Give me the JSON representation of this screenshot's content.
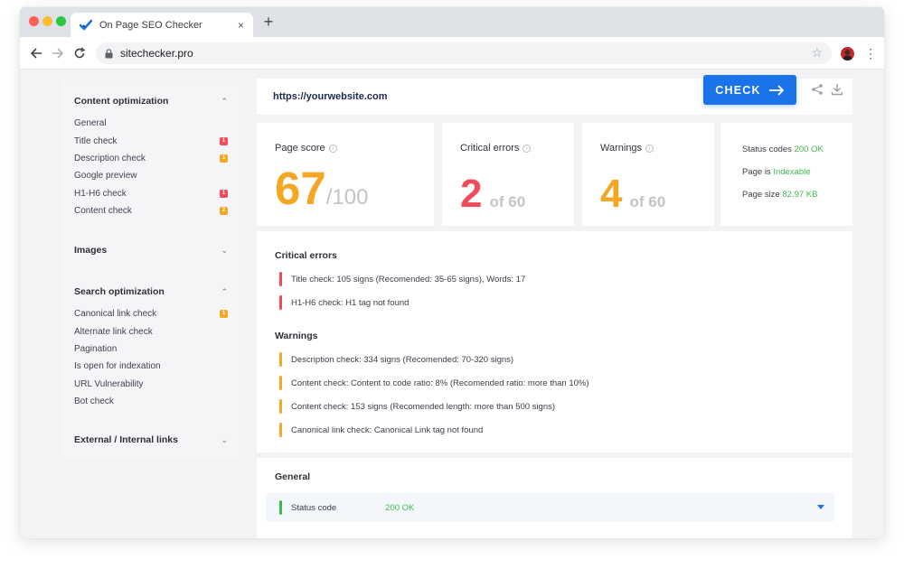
{
  "browser": {
    "tab_title": "On Page SEO Checker",
    "tab_close": "×",
    "new_tab": "+",
    "url": "sitechecker.pro",
    "bookmark_star": "☆",
    "menu": "⋮"
  },
  "sidebar": {
    "sections": [
      {
        "title": "Content optimization",
        "chevron": "⌃",
        "items": [
          {
            "label": "General",
            "badge": ""
          },
          {
            "label": "Title check",
            "badge": "1",
            "badge_color": "red"
          },
          {
            "label": "Description check",
            "badge": "1",
            "badge_color": "amber"
          },
          {
            "label": "Google preview",
            "badge": ""
          },
          {
            "label": "H1-H6 check",
            "badge": "1",
            "badge_color": "red"
          },
          {
            "label": "Content check",
            "badge": "2",
            "badge_color": "amber"
          }
        ]
      },
      {
        "title": "Images",
        "chevron": "⌄",
        "items": []
      },
      {
        "title": "Search optimization",
        "chevron": "⌃",
        "items": [
          {
            "label": "Canonical link check",
            "badge": "1",
            "badge_color": "amber"
          },
          {
            "label": "Alternate link check",
            "badge": ""
          },
          {
            "label": "Pagination",
            "badge": ""
          },
          {
            "label": "Is open for indexation",
            "badge": ""
          },
          {
            "label": "URL Vulnerability",
            "badge": ""
          },
          {
            "label": "Bot check",
            "badge": ""
          }
        ]
      },
      {
        "title": "External / Internal links",
        "chevron": "⌄",
        "items": []
      }
    ]
  },
  "checker": {
    "url_value": "https://yourwebsite.com",
    "check_label": "CHECK"
  },
  "scores": {
    "page_score": {
      "label": "Page score",
      "value": "67",
      "suffix": "/100",
      "color": "#f5a623"
    },
    "critical_errors": {
      "label": "Critical errors",
      "value": "2",
      "suffix": "of 60",
      "color": "#f24a5a"
    },
    "warnings": {
      "label": "Warnings",
      "value": "4",
      "suffix": "of 60",
      "color": "#f5a623"
    }
  },
  "stats": {
    "status_codes_label": "Status codes",
    "status_codes_value": "200 OK",
    "page_is_label": "Page is",
    "page_is_value": "Indexable",
    "page_size_label": "Page size",
    "page_size_value": "82.97 KB"
  },
  "critical_section": {
    "title": "Critical errors",
    "items": [
      "Title check: 105 signs (Recomended: 35-65 signs), Words: 17",
      "H1-H6 check: H1 tag not found"
    ]
  },
  "warnings_section": {
    "title": "Warnings",
    "items": [
      "Description check: 334 signs (Recomended: 70-320 signs)",
      "Content check: Content to code ratio: 8% (Recomended ratio: more than 10%)",
      "Content check: 153 signs (Recomended length: more than 500 signs)",
      "Canonical link check: Canonical Link tag not found"
    ]
  },
  "general_section": {
    "title": "General",
    "status_label": "Status code",
    "status_value": "200 OK"
  },
  "colors": {
    "accent": "#1a73e8",
    "error": "#f24a5a",
    "warning": "#f5a623",
    "success": "#3dbb4e"
  }
}
